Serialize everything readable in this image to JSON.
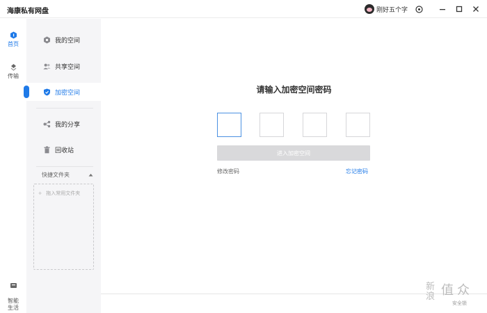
{
  "app": {
    "title": "海康私有网盘"
  },
  "user": {
    "name": "刚好五个字"
  },
  "rail": {
    "items": [
      {
        "label": "首页"
      },
      {
        "label": "传输"
      },
      {
        "label": "智能\n生活"
      }
    ]
  },
  "sidebar": {
    "items": [
      {
        "label": "我的空间",
        "icon": "space-icon"
      },
      {
        "label": "共享空间",
        "icon": "users-icon"
      },
      {
        "label": "加密空间",
        "icon": "shield-icon"
      },
      {
        "label": "我的分享",
        "icon": "share-icon"
      },
      {
        "label": "回收站",
        "icon": "trash-icon"
      }
    ],
    "quick_folder": {
      "title": "快捷文件夹",
      "hint": "拖入常用文件夹"
    }
  },
  "encrypted": {
    "heading": "请输入加密空间密码",
    "enter_button": "进入加密空间",
    "change_password": "修改密码",
    "forgot_password": "忘记密码"
  },
  "watermark": {
    "text_main": "值 众",
    "text_side": "新浪",
    "text_sub": "安全锁"
  },
  "colors": {
    "accent": "#1f7ae8",
    "panel_bg": "#f5f5f7",
    "disabled_btn": "#d9d9db"
  }
}
